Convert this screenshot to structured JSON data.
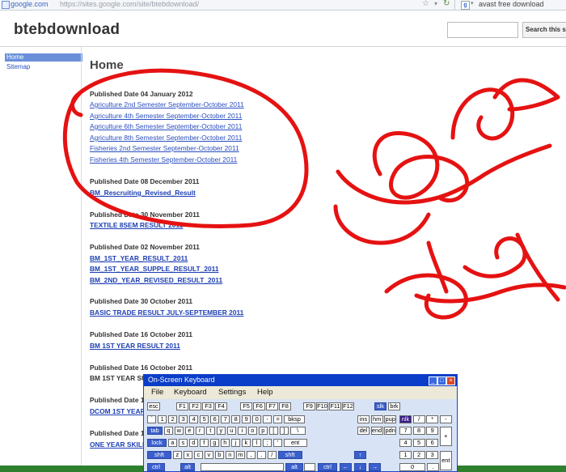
{
  "browser": {
    "domain_label": "google.com",
    "url": "https://sites.google.com/site/btebdownload/",
    "search_text": "avast free download",
    "search_engine_icon": "google-icon"
  },
  "site": {
    "title": "btebdownload",
    "search_button": "Search this site"
  },
  "sidebar": {
    "items": [
      {
        "label": "Home",
        "selected": true
      },
      {
        "label": "Sitemap",
        "selected": false
      }
    ]
  },
  "main": {
    "title": "Home",
    "dates": [
      "Published Date 04 January 2012",
      "Published Date 08 December 2011",
      "Published Date 30 November 2011",
      "Published Date 02 November 2011",
      "Published Date 30 October 2011",
      "Published Date 16 October 2011",
      "Published Date 16 October 2011",
      "Published Date 1",
      "Published Date 1"
    ],
    "links_jan": [
      "Agriculture 2nd Semester September-October 2011",
      "Agriculture 4th Semester  September-October 2011",
      "Agriculture 6th Semester  September-October 2011",
      "Agriculture 8th Semester  September-October 2011",
      "Fisheries 2nd Semester  September-October 2011",
      "Fisheries 4th Semester  September-October 2011"
    ],
    "link_dec": "BM_Rescruiting_Revised_Result",
    "link_nov30": "TEXTILE 8SEM RESULT 2011",
    "links_nov02": [
      "BM_1ST_YEAR_RESULT_2011",
      "BM_1ST_YEAR_SUPPLE_RESULT_2011",
      "BM_2ND_YEAR_REVISED_RESULT_2011"
    ],
    "link_oct30": "BASIC TRADE RESULT JULY-SEPTEMBER 2011",
    "link_oct16": "BM 1ST YEAR RESULT 2011",
    "text_oct16b": "BM 1ST YEAR SU",
    "link_dcom": "DCOM 1ST YEAR",
    "link_skill": "ONE YEAR SKILL"
  },
  "osk": {
    "title": "On-Screen Keyboard",
    "menu": [
      "File",
      "Keyboard",
      "Settings",
      "Help"
    ],
    "rows": [
      [
        "esc",
        "F1",
        "F2",
        "F3",
        "F4",
        "F5",
        "F6",
        "F7",
        "F8",
        "F9",
        "F10",
        "F11",
        "F12",
        "slk",
        "brk"
      ],
      [
        "`",
        "1",
        "2",
        "3",
        "4",
        "5",
        "6",
        "7",
        "8",
        "9",
        "0",
        "-",
        "=",
        "bksp",
        "ins",
        "hm",
        "pup",
        "nlk",
        "/",
        "*",
        "-"
      ],
      [
        "tab",
        "q",
        "w",
        "e",
        "r",
        "t",
        "y",
        "u",
        "i",
        "o",
        "p",
        "[",
        "]",
        "\\",
        "del",
        "end",
        "pdn",
        "7",
        "8",
        "9",
        "+"
      ],
      [
        "lock",
        "a",
        "s",
        "d",
        "f",
        "g",
        "h",
        "j",
        "k",
        "l",
        ";",
        "'",
        "ent",
        "4",
        "5",
        "6"
      ],
      [
        "shft",
        "z",
        "x",
        "c",
        "v",
        "b",
        "n",
        "m",
        ",",
        ".",
        "/",
        "shft",
        "1",
        "2",
        "3",
        "ent"
      ],
      [
        "ctrl",
        "alt",
        "alt",
        "ctrl",
        "0",
        "."
      ]
    ]
  },
  "colors": {
    "link": "#2a4fc0",
    "ink": "#e51212",
    "osk_title": "#0a3dc8",
    "sidebar_selected": "#6a8fd9"
  }
}
